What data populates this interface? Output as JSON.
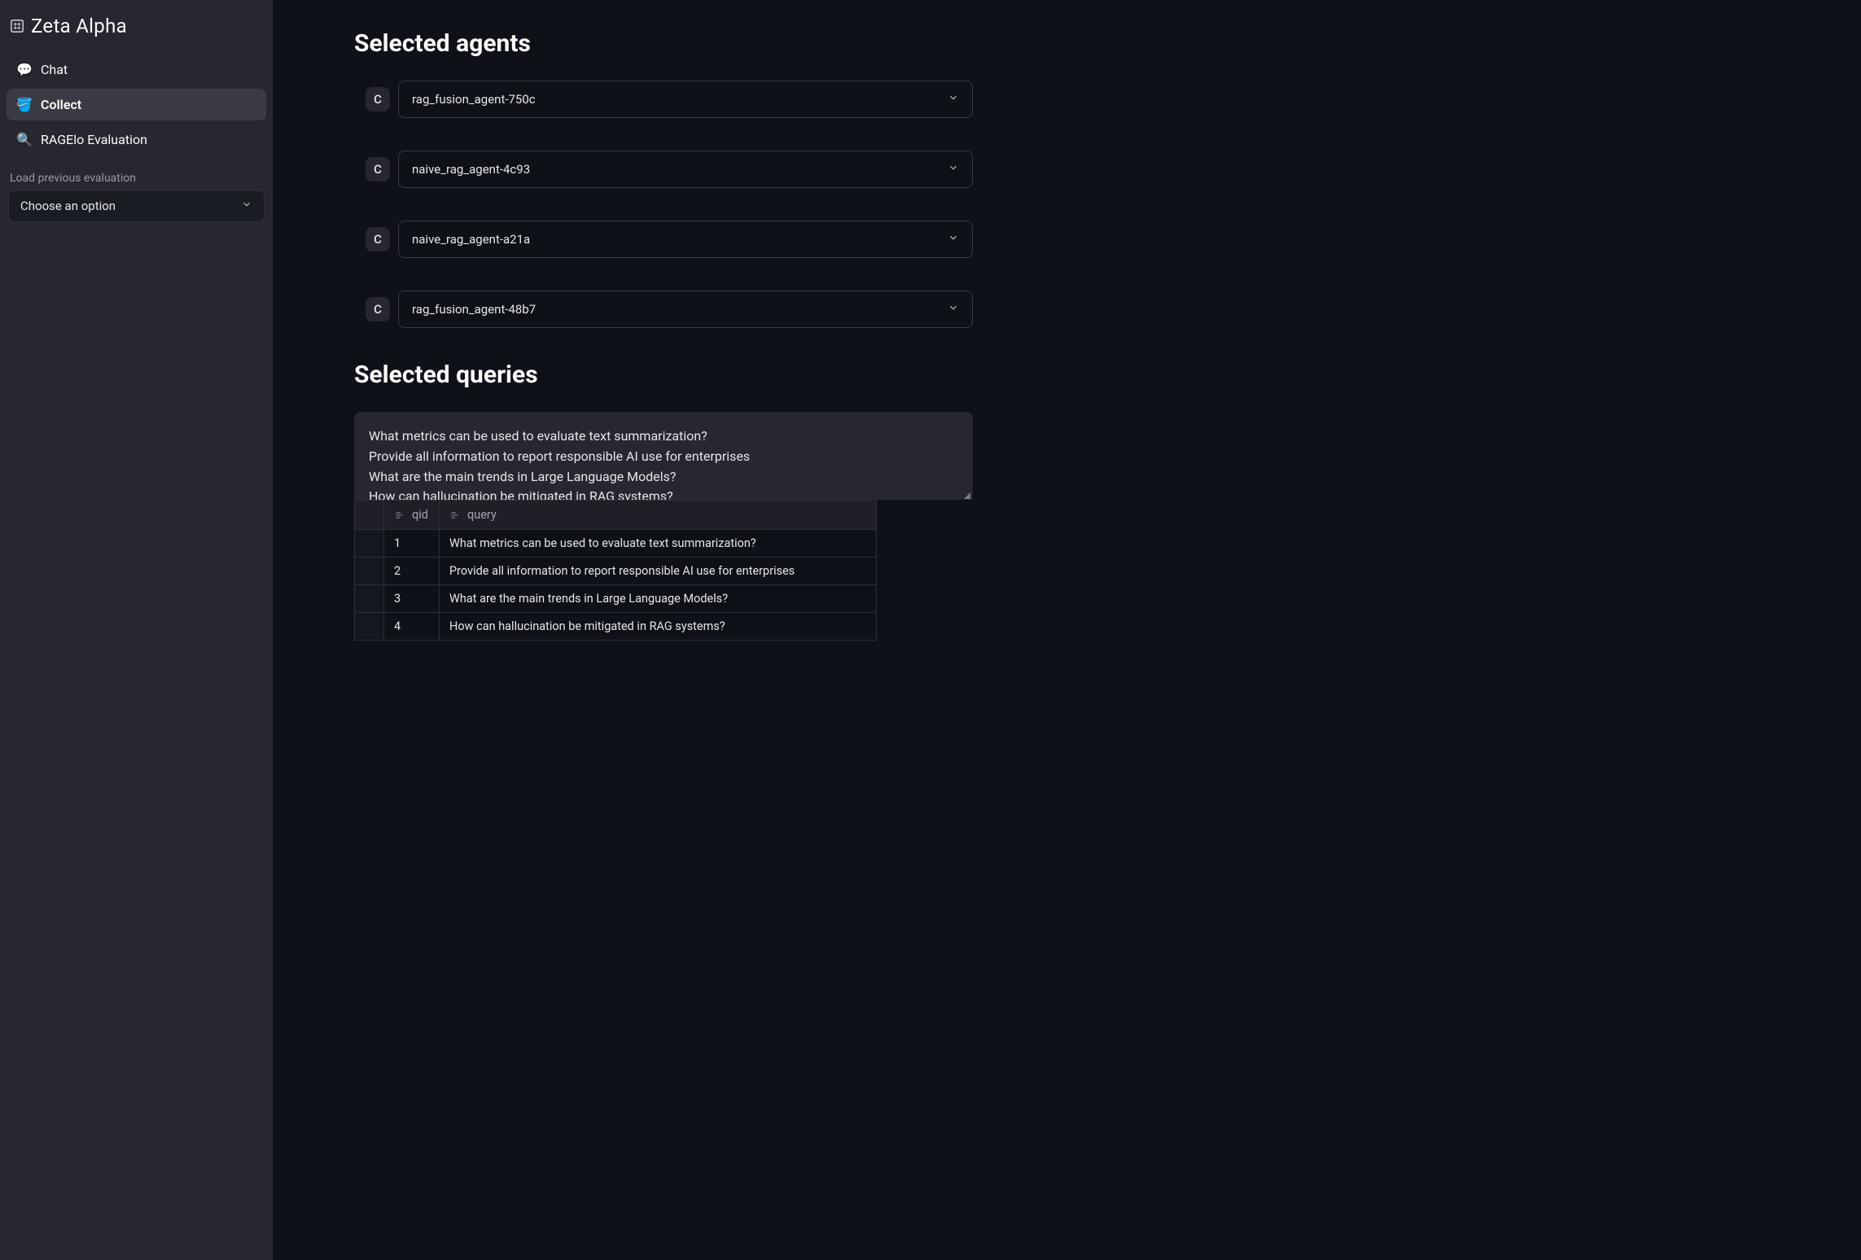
{
  "brand": {
    "name": "Zeta Alpha"
  },
  "sidebar": {
    "nav": [
      {
        "emoji": "💬",
        "label": "Chat"
      },
      {
        "emoji": "🪣",
        "label": "Collect"
      },
      {
        "emoji": "🔍",
        "label": "RAGElo Evaluation"
      }
    ],
    "load_label": "Load previous evaluation",
    "select_placeholder": "Choose an option"
  },
  "agents": {
    "heading": "Selected agents",
    "items": [
      {
        "badge": "C",
        "name": "rag_fusion_agent-750c"
      },
      {
        "badge": "C",
        "name": "naive_rag_agent-4c93"
      },
      {
        "badge": "C",
        "name": "naive_rag_agent-a21a"
      },
      {
        "badge": "C",
        "name": "rag_fusion_agent-48b7"
      }
    ]
  },
  "queries": {
    "heading": "Selected queries",
    "textarea_lines": [
      "What metrics can be used to evaluate text summarization?",
      "Provide all information to report responsible AI use for enterprises",
      "What are the main trends in Large Language Models?",
      "How can hallucination be mitigated in RAG systems?"
    ],
    "table": {
      "columns": {
        "qid": "qid",
        "query": "query"
      },
      "rows": [
        {
          "qid": "1",
          "query": "What metrics can be used to evaluate text summarization?"
        },
        {
          "qid": "2",
          "query": "Provide all information to report responsible AI use for enterprises"
        },
        {
          "qid": "3",
          "query": "What are the main trends in Large Language Models?"
        },
        {
          "qid": "4",
          "query": "How can hallucination be mitigated in RAG systems?"
        }
      ]
    }
  }
}
